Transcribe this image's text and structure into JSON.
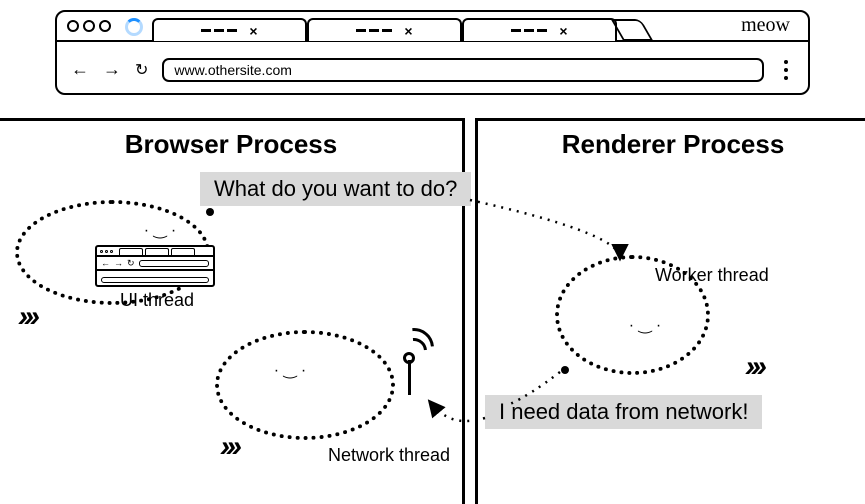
{
  "browser_chrome": {
    "brand": "meow",
    "url": "www.othersite.com",
    "nav": {
      "back": "←",
      "forward": "→",
      "reload": "↻"
    }
  },
  "processes": {
    "browser": {
      "title": "Browser Process"
    },
    "renderer": {
      "title": "Renderer Process"
    }
  },
  "speech": {
    "q": "What do you want to do?",
    "a": "I need data from network!"
  },
  "threads": {
    "ui": "UI thread",
    "network": "Network thread",
    "worker": "Worker thread"
  }
}
